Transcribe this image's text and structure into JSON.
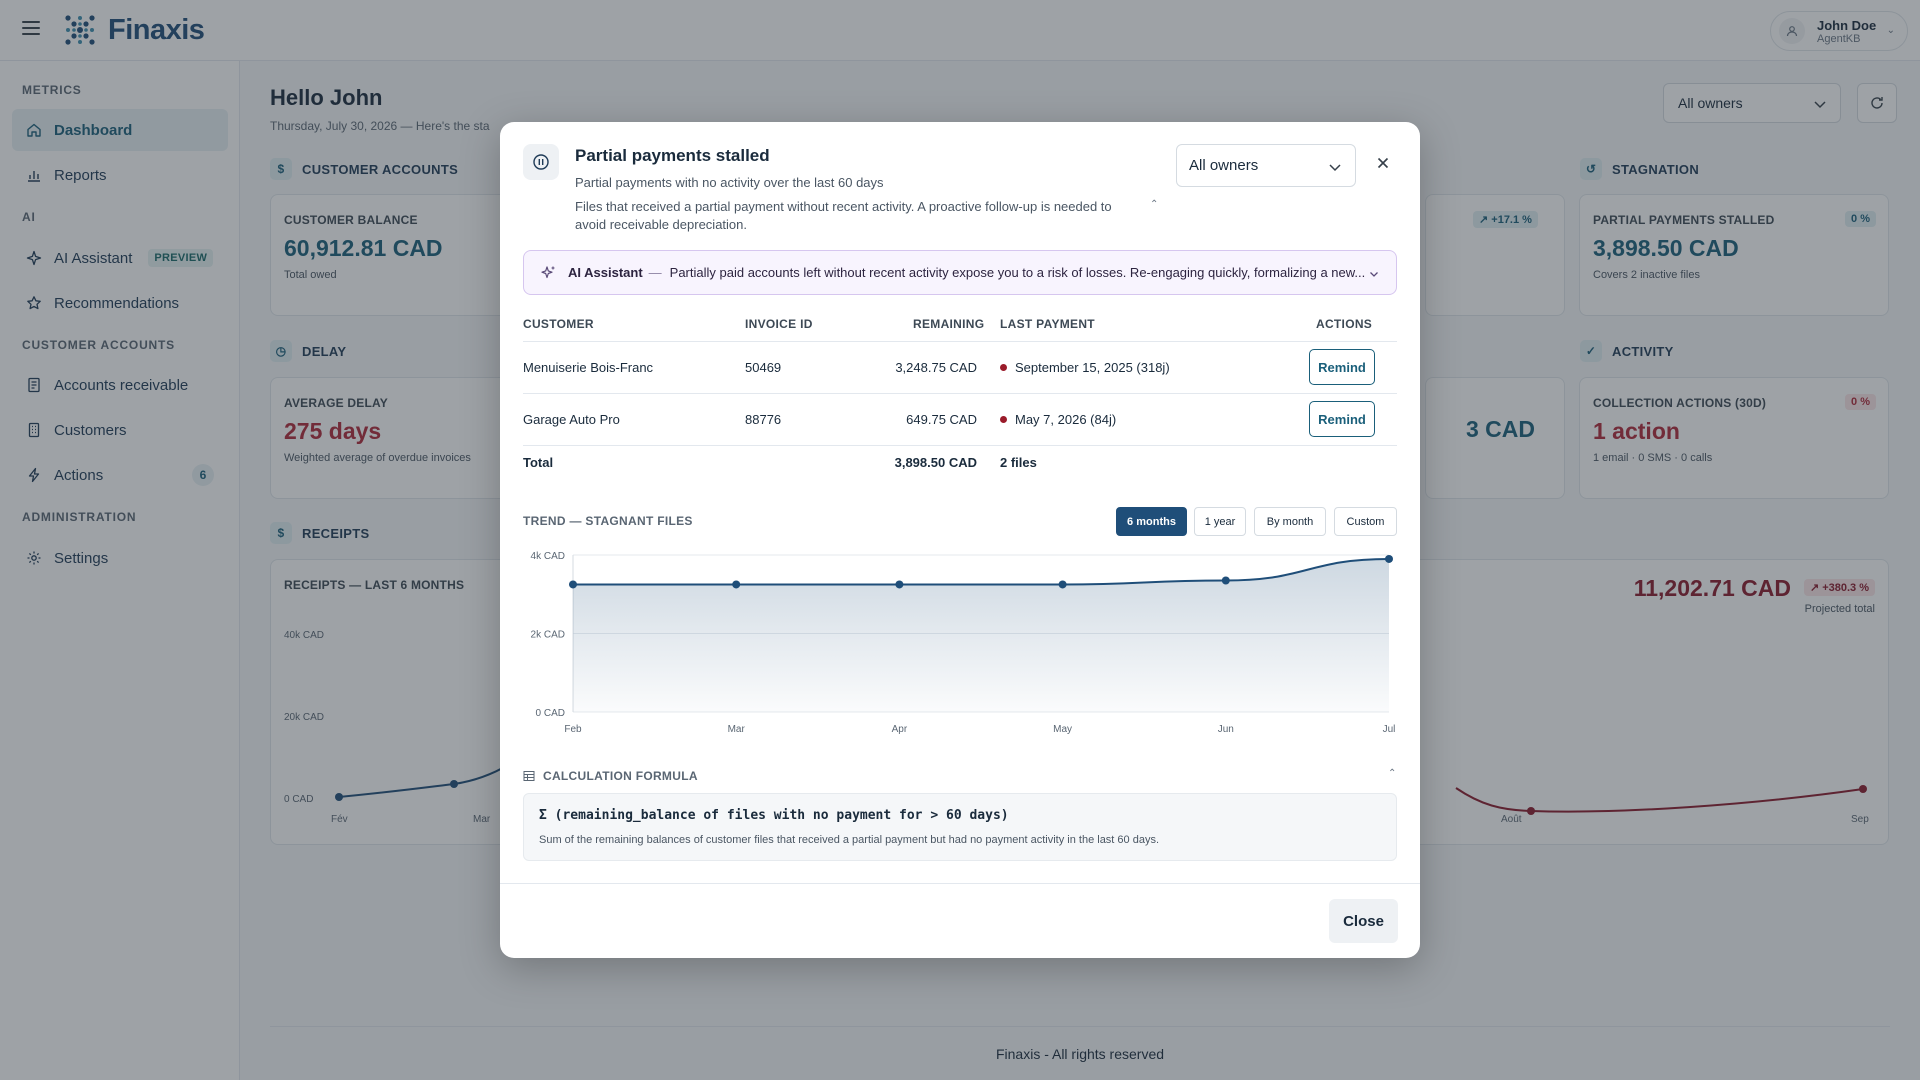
{
  "app": {
    "name": "Finaxis"
  },
  "user": {
    "name": "John Doe",
    "org": "AgentKB"
  },
  "sidebar": {
    "sections": {
      "metrics": "METRICS",
      "ai": "AI",
      "customer_accounts": "CUSTOMER ACCOUNTS",
      "administration": "ADMINISTRATION"
    },
    "items": {
      "dashboard": "Dashboard",
      "reports": "Reports",
      "ai_assistant": "AI Assistant",
      "ai_badge": "PREVIEW",
      "recommendations": "Recommendations",
      "accounts_receivable": "Accounts receivable",
      "customers": "Customers",
      "actions": "Actions",
      "actions_count": "6",
      "settings": "Settings"
    }
  },
  "header": {
    "greeting": "Hello John",
    "subtitle": "Thursday, July 30, 2026 — Here's the sta",
    "owner_filter": "All owners"
  },
  "sections": {
    "customer_accounts": "CUSTOMER ACCOUNTS",
    "stagnation": "STAGNATION",
    "delay": "DELAY",
    "activity": "ACTIVITY",
    "receipts": "RECEIPTS"
  },
  "cards": {
    "customer_balance": {
      "title": "CUSTOMER BALANCE",
      "value": "60,912.81 CAD",
      "sub": "Total owed"
    },
    "hidden_trend_pill": "↗ +17.1 %",
    "partial_stalled": {
      "title": "PARTIAL PAYMENTS STALLED",
      "value": "3,898.50 CAD",
      "sub": "Covers 2 inactive files",
      "pill": "0 %"
    },
    "average_delay": {
      "title": "AVERAGE DELAY",
      "value": "275 days",
      "sub": "Weighted average of overdue invoices"
    },
    "hidden_value": "3 CAD",
    "collection_actions": {
      "title": "COLLECTION ACTIONS (30D)",
      "value": "1 action",
      "sub": "1 email · 0 SMS · 0 calls",
      "pill": "0 %"
    },
    "receipts": {
      "title": "RECEIPTS — LAST 6 MONTHS",
      "projected_value": "11,202.71 CAD",
      "projected_pill": "↗ +380.3 %",
      "projected_label": "Projected total",
      "y_ticks": [
        "40k CAD",
        "20k CAD",
        "0 CAD"
      ],
      "x_left": [
        "Fév",
        "Mar"
      ],
      "x_right": [
        "Août",
        "Sep"
      ]
    }
  },
  "modal": {
    "title": "Partial payments stalled",
    "subtitle": "Partial payments with no activity over the last 60 days",
    "description": "Files that received a partial payment without recent activity. A proactive follow-up is needed to avoid receivable depreciation.",
    "owner_filter": "All owners",
    "ai": {
      "label": "AI Assistant",
      "separator": "—",
      "message": "Partially paid accounts left without recent activity expose you to a risk of losses. Re-engaging quickly, formalizing a new..."
    },
    "table": {
      "headers": [
        "CUSTOMER",
        "INVOICE ID",
        "REMAINING",
        "LAST PAYMENT",
        "ACTIONS"
      ],
      "rows": [
        {
          "customer": "Menuiserie Bois-Franc",
          "invoice": "50469",
          "remaining": "3,248.75 CAD",
          "last_payment": "September 15, 2025 (318j)",
          "action": "Remind"
        },
        {
          "customer": "Garage Auto Pro",
          "invoice": "88776",
          "remaining": "649.75 CAD",
          "last_payment": "May 7, 2026 (84j)",
          "action": "Remind"
        }
      ],
      "total_label": "Total",
      "total_value": "3,898.50 CAD",
      "total_files": "2 files"
    },
    "trend": {
      "title": "TREND — STAGNANT FILES",
      "ranges": [
        "6 months",
        "1 year",
        "By month",
        "Custom"
      ],
      "selected_range": "6 months"
    },
    "formula": {
      "title": "CALCULATION FORMULA",
      "code": "Σ (remaining_balance of files with no payment for > 60 days)",
      "description": "Sum of the remaining balances of customer files that received a partial payment but had no payment activity in the last 60 days."
    },
    "close_label": "Close"
  },
  "chart_data": {
    "type": "area",
    "categories": [
      "Feb",
      "Mar",
      "Apr",
      "May",
      "Jun",
      "Jul"
    ],
    "values": [
      3250,
      3250,
      3250,
      3250,
      3350,
      3898.5
    ],
    "ylim": [
      0,
      4000
    ],
    "y_ticks": [
      "4k CAD",
      "2k CAD",
      "0 CAD"
    ],
    "title": "TREND — STAGNANT FILES",
    "xlabel": "",
    "ylabel": "",
    "grid": true
  },
  "footer": {
    "text": "Finaxis - All rights reserved"
  },
  "colors": {
    "brand": "#1f4e79",
    "accent": "#1a5f7a",
    "danger": "#b0283a",
    "dark_red": "#8a1a2c",
    "ai_bg": "#f8f4fe"
  }
}
